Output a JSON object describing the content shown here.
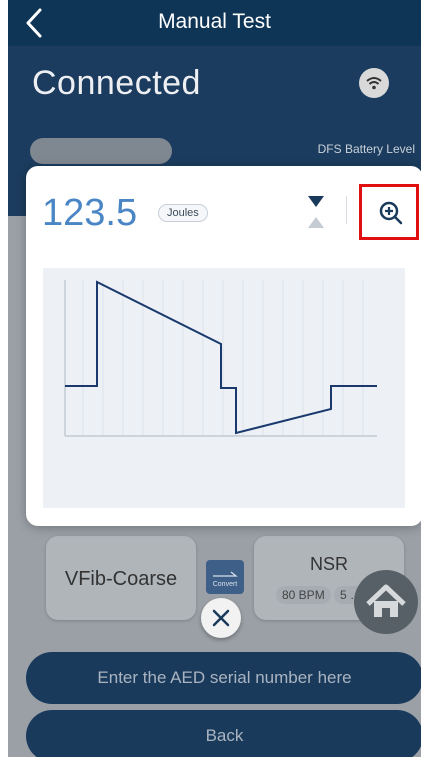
{
  "header": {
    "title": "Manual Test"
  },
  "status": {
    "connection": "Connected",
    "battery_label": "DFS Battery Level"
  },
  "modal": {
    "energy_value": "123.5",
    "energy_unit": "Joules"
  },
  "rhythms": {
    "from": "VFib-Coarse",
    "to": "NSR",
    "bpm": "80 BPM",
    "rate": "5 …",
    "convert_label": "Convert"
  },
  "buttons": {
    "aed_serial": "Enter the AED serial number here",
    "back": "Back"
  },
  "icons": {
    "back": "chevron-left-icon",
    "wifi": "wifi-icon",
    "hourglass": "hourglass-icon",
    "zoom": "zoom-in-icon",
    "home": "home-icon",
    "close": "close-icon"
  },
  "colors": {
    "navy": "#0f3556",
    "accent": "#4a86c5",
    "highlight": "#e01010"
  }
}
